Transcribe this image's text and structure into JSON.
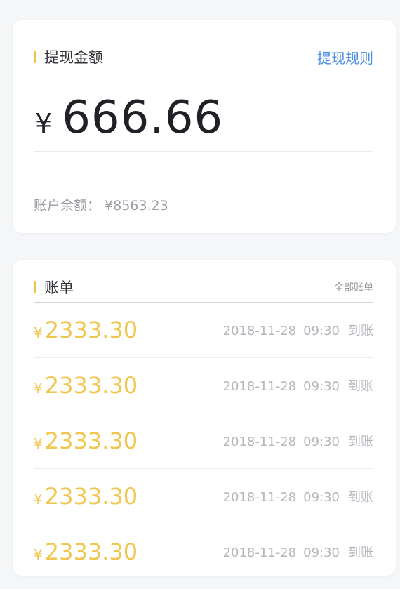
{
  "withdraw": {
    "title": "提现金额",
    "rules_link": "提现规则",
    "currency_symbol": "¥",
    "amount": "666.66",
    "balance_label": "账户余额：",
    "balance_value": "¥8563.23"
  },
  "bill": {
    "title": "账单",
    "all_link": "全部账单",
    "items": [
      {
        "currency": "¥",
        "amount": "2333.30",
        "date": "2018-11-28",
        "time": "09:30",
        "status": "到账"
      },
      {
        "currency": "¥",
        "amount": "2333.30",
        "date": "2018-11-28",
        "time": "09:30",
        "status": "到账"
      },
      {
        "currency": "¥",
        "amount": "2333.30",
        "date": "2018-11-28",
        "time": "09:30",
        "status": "到账"
      },
      {
        "currency": "¥",
        "amount": "2333.30",
        "date": "2018-11-28",
        "time": "09:30",
        "status": "到账"
      },
      {
        "currency": "¥",
        "amount": "2333.30",
        "date": "2018-11-28",
        "time": "09:30",
        "status": "到账"
      }
    ]
  },
  "colors": {
    "accent": "#f3c24d",
    "link": "#4a8fe2",
    "amount_gold": "#f1c64e",
    "background": "#f5f6f8"
  }
}
